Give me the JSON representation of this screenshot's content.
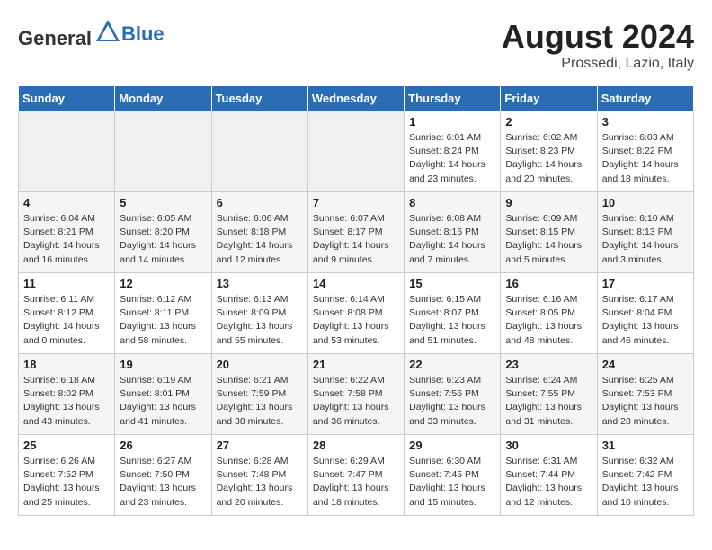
{
  "header": {
    "logo_general": "General",
    "logo_blue": "Blue",
    "month_year": "August 2024",
    "location": "Prossedi, Lazio, Italy"
  },
  "days_of_week": [
    "Sunday",
    "Monday",
    "Tuesday",
    "Wednesday",
    "Thursday",
    "Friday",
    "Saturday"
  ],
  "weeks": [
    [
      {
        "day": "",
        "info": ""
      },
      {
        "day": "",
        "info": ""
      },
      {
        "day": "",
        "info": ""
      },
      {
        "day": "",
        "info": ""
      },
      {
        "day": "1",
        "info": "Sunrise: 6:01 AM\nSunset: 8:24 PM\nDaylight: 14 hours\nand 23 minutes."
      },
      {
        "day": "2",
        "info": "Sunrise: 6:02 AM\nSunset: 8:23 PM\nDaylight: 14 hours\nand 20 minutes."
      },
      {
        "day": "3",
        "info": "Sunrise: 6:03 AM\nSunset: 8:22 PM\nDaylight: 14 hours\nand 18 minutes."
      }
    ],
    [
      {
        "day": "4",
        "info": "Sunrise: 6:04 AM\nSunset: 8:21 PM\nDaylight: 14 hours\nand 16 minutes."
      },
      {
        "day": "5",
        "info": "Sunrise: 6:05 AM\nSunset: 8:20 PM\nDaylight: 14 hours\nand 14 minutes."
      },
      {
        "day": "6",
        "info": "Sunrise: 6:06 AM\nSunset: 8:18 PM\nDaylight: 14 hours\nand 12 minutes."
      },
      {
        "day": "7",
        "info": "Sunrise: 6:07 AM\nSunset: 8:17 PM\nDaylight: 14 hours\nand 9 minutes."
      },
      {
        "day": "8",
        "info": "Sunrise: 6:08 AM\nSunset: 8:16 PM\nDaylight: 14 hours\nand 7 minutes."
      },
      {
        "day": "9",
        "info": "Sunrise: 6:09 AM\nSunset: 8:15 PM\nDaylight: 14 hours\nand 5 minutes."
      },
      {
        "day": "10",
        "info": "Sunrise: 6:10 AM\nSunset: 8:13 PM\nDaylight: 14 hours\nand 3 minutes."
      }
    ],
    [
      {
        "day": "11",
        "info": "Sunrise: 6:11 AM\nSunset: 8:12 PM\nDaylight: 14 hours\nand 0 minutes."
      },
      {
        "day": "12",
        "info": "Sunrise: 6:12 AM\nSunset: 8:11 PM\nDaylight: 13 hours\nand 58 minutes."
      },
      {
        "day": "13",
        "info": "Sunrise: 6:13 AM\nSunset: 8:09 PM\nDaylight: 13 hours\nand 55 minutes."
      },
      {
        "day": "14",
        "info": "Sunrise: 6:14 AM\nSunset: 8:08 PM\nDaylight: 13 hours\nand 53 minutes."
      },
      {
        "day": "15",
        "info": "Sunrise: 6:15 AM\nSunset: 8:07 PM\nDaylight: 13 hours\nand 51 minutes."
      },
      {
        "day": "16",
        "info": "Sunrise: 6:16 AM\nSunset: 8:05 PM\nDaylight: 13 hours\nand 48 minutes."
      },
      {
        "day": "17",
        "info": "Sunrise: 6:17 AM\nSunset: 8:04 PM\nDaylight: 13 hours\nand 46 minutes."
      }
    ],
    [
      {
        "day": "18",
        "info": "Sunrise: 6:18 AM\nSunset: 8:02 PM\nDaylight: 13 hours\nand 43 minutes."
      },
      {
        "day": "19",
        "info": "Sunrise: 6:19 AM\nSunset: 8:01 PM\nDaylight: 13 hours\nand 41 minutes."
      },
      {
        "day": "20",
        "info": "Sunrise: 6:21 AM\nSunset: 7:59 PM\nDaylight: 13 hours\nand 38 minutes."
      },
      {
        "day": "21",
        "info": "Sunrise: 6:22 AM\nSunset: 7:58 PM\nDaylight: 13 hours\nand 36 minutes."
      },
      {
        "day": "22",
        "info": "Sunrise: 6:23 AM\nSunset: 7:56 PM\nDaylight: 13 hours\nand 33 minutes."
      },
      {
        "day": "23",
        "info": "Sunrise: 6:24 AM\nSunset: 7:55 PM\nDaylight: 13 hours\nand 31 minutes."
      },
      {
        "day": "24",
        "info": "Sunrise: 6:25 AM\nSunset: 7:53 PM\nDaylight: 13 hours\nand 28 minutes."
      }
    ],
    [
      {
        "day": "25",
        "info": "Sunrise: 6:26 AM\nSunset: 7:52 PM\nDaylight: 13 hours\nand 25 minutes."
      },
      {
        "day": "26",
        "info": "Sunrise: 6:27 AM\nSunset: 7:50 PM\nDaylight: 13 hours\nand 23 minutes."
      },
      {
        "day": "27",
        "info": "Sunrise: 6:28 AM\nSunset: 7:48 PM\nDaylight: 13 hours\nand 20 minutes."
      },
      {
        "day": "28",
        "info": "Sunrise: 6:29 AM\nSunset: 7:47 PM\nDaylight: 13 hours\nand 18 minutes."
      },
      {
        "day": "29",
        "info": "Sunrise: 6:30 AM\nSunset: 7:45 PM\nDaylight: 13 hours\nand 15 minutes."
      },
      {
        "day": "30",
        "info": "Sunrise: 6:31 AM\nSunset: 7:44 PM\nDaylight: 13 hours\nand 12 minutes."
      },
      {
        "day": "31",
        "info": "Sunrise: 6:32 AM\nSunset: 7:42 PM\nDaylight: 13 hours\nand 10 minutes."
      }
    ]
  ]
}
